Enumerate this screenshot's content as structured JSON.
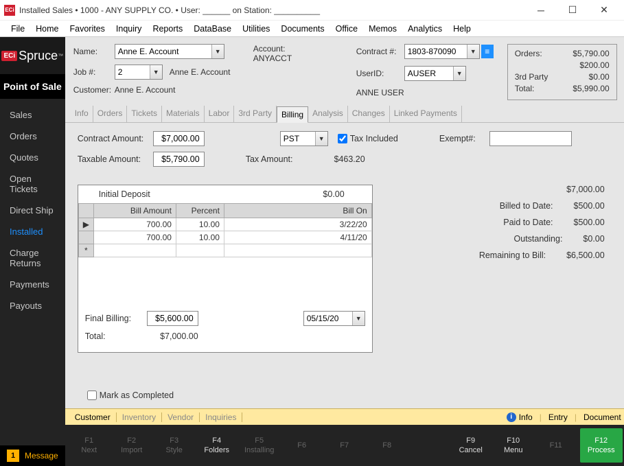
{
  "titlebar": {
    "app_icon_text": "ECi",
    "title": "Installed Sales  •  1000 - ANY SUPPLY CO.  •  User: ______ on Station: __________"
  },
  "menubar": [
    "File",
    "Home",
    "Favorites",
    "Inquiry",
    "Reports",
    "DataBase",
    "Utilities",
    "Documents",
    "Office",
    "Memos",
    "Analytics",
    "Help"
  ],
  "logo": {
    "eci": "ECi",
    "spruce": "Spruce",
    "tm": "™"
  },
  "sidebar": {
    "header": "Point of Sale",
    "items": [
      "Sales",
      "Orders",
      "Quotes",
      "Open Tickets",
      "Direct Ship",
      "Installed",
      "Charge Returns",
      "Payments",
      "Payouts"
    ],
    "active_index": 5,
    "message_badge": "1",
    "message_text": "Message"
  },
  "header": {
    "name_label": "Name:",
    "name_value": "Anne E. Account",
    "job_label": "Job #:",
    "job_value": "2",
    "job_name": "Anne E. Account",
    "customer_label": "Customer:",
    "customer_value": "Anne E. Account",
    "account_label": "Account:",
    "account_value": "ANYACCT",
    "contract_label": "Contract #:",
    "contract_value": "1803-870090",
    "userid_label": "UserID:",
    "userid_value": "AUSER",
    "username": "ANNE USER"
  },
  "summary": {
    "orders_label": "Orders:",
    "orders_value": "$5,790.00",
    "adjust_value": "$200.00",
    "thirdparty_label": "3rd Party",
    "thirdparty_value": "$0.00",
    "total_label": "Total:",
    "total_value": "$5,990.00"
  },
  "tabs": [
    "Info",
    "Orders",
    "Tickets",
    "Materials",
    "Labor",
    "3rd Party",
    "Billing",
    "Analysis",
    "Changes",
    "Linked Payments"
  ],
  "tabs_active_index": 6,
  "billing": {
    "contract_amount_label": "Contract Amount:",
    "contract_amount_value": "$7,000.00",
    "taxable_amount_label": "Taxable Amount:",
    "taxable_amount_value": "$5,790.00",
    "tax_code_value": "PST",
    "tax_included_label": "Tax Included",
    "tax_amount_label": "Tax Amount:",
    "tax_amount_value": "$463.20",
    "exempt_label": "Exempt#:",
    "exempt_value": "",
    "initial_deposit_label": "Initial Deposit",
    "initial_deposit_value": "$0.00",
    "grid_headers": {
      "bill_amount": "Bill Amount",
      "percent": "Percent",
      "bill_on": "Bill On"
    },
    "rows": [
      {
        "bill_amount": "700.00",
        "percent": "10.00",
        "bill_on": "3/22/20"
      },
      {
        "bill_amount": "700.00",
        "percent": "10.00",
        "bill_on": "4/11/20"
      }
    ],
    "final_billing_label": "Final Billing:",
    "final_billing_value": "$5,600.00",
    "final_billing_date": "05/15/20",
    "total_label": "Total:",
    "total_value": "$7,000.00",
    "mark_completed_label": "Mark as Completed"
  },
  "right_totals": {
    "top_value": "$7,000.00",
    "billed_label": "Billed to Date:",
    "billed_value": "$500.00",
    "paid_label": "Paid to Date:",
    "paid_value": "$500.00",
    "outstanding_label": "Outstanding:",
    "outstanding_value": "$0.00",
    "remaining_label": "Remaining to Bill:",
    "remaining_value": "$6,500.00"
  },
  "bottom_tabs": {
    "items": [
      "Customer",
      "Inventory",
      "Vendor",
      "Inquiries"
    ],
    "active_index": 0,
    "info": "Info",
    "entry": "Entry",
    "document": "Document"
  },
  "fkeys": [
    {
      "num": "F1",
      "name": "Next",
      "enabled": false
    },
    {
      "num": "F2",
      "name": "Import",
      "enabled": false
    },
    {
      "num": "F3",
      "name": "Style",
      "enabled": false
    },
    {
      "num": "F4",
      "name": "Folders",
      "enabled": true
    },
    {
      "num": "F5",
      "name": "Installing",
      "enabled": false
    },
    {
      "num": "F6",
      "name": "",
      "enabled": false
    },
    {
      "num": "F7",
      "name": "",
      "enabled": false
    },
    {
      "num": "F8",
      "name": "",
      "enabled": false
    },
    {
      "num": "F9",
      "name": "Cancel",
      "enabled": true
    },
    {
      "num": "F10",
      "name": "Menu",
      "enabled": true
    },
    {
      "num": "F11",
      "name": "",
      "enabled": false
    },
    {
      "num": "F12",
      "name": "Process",
      "enabled": true,
      "green": true
    }
  ]
}
